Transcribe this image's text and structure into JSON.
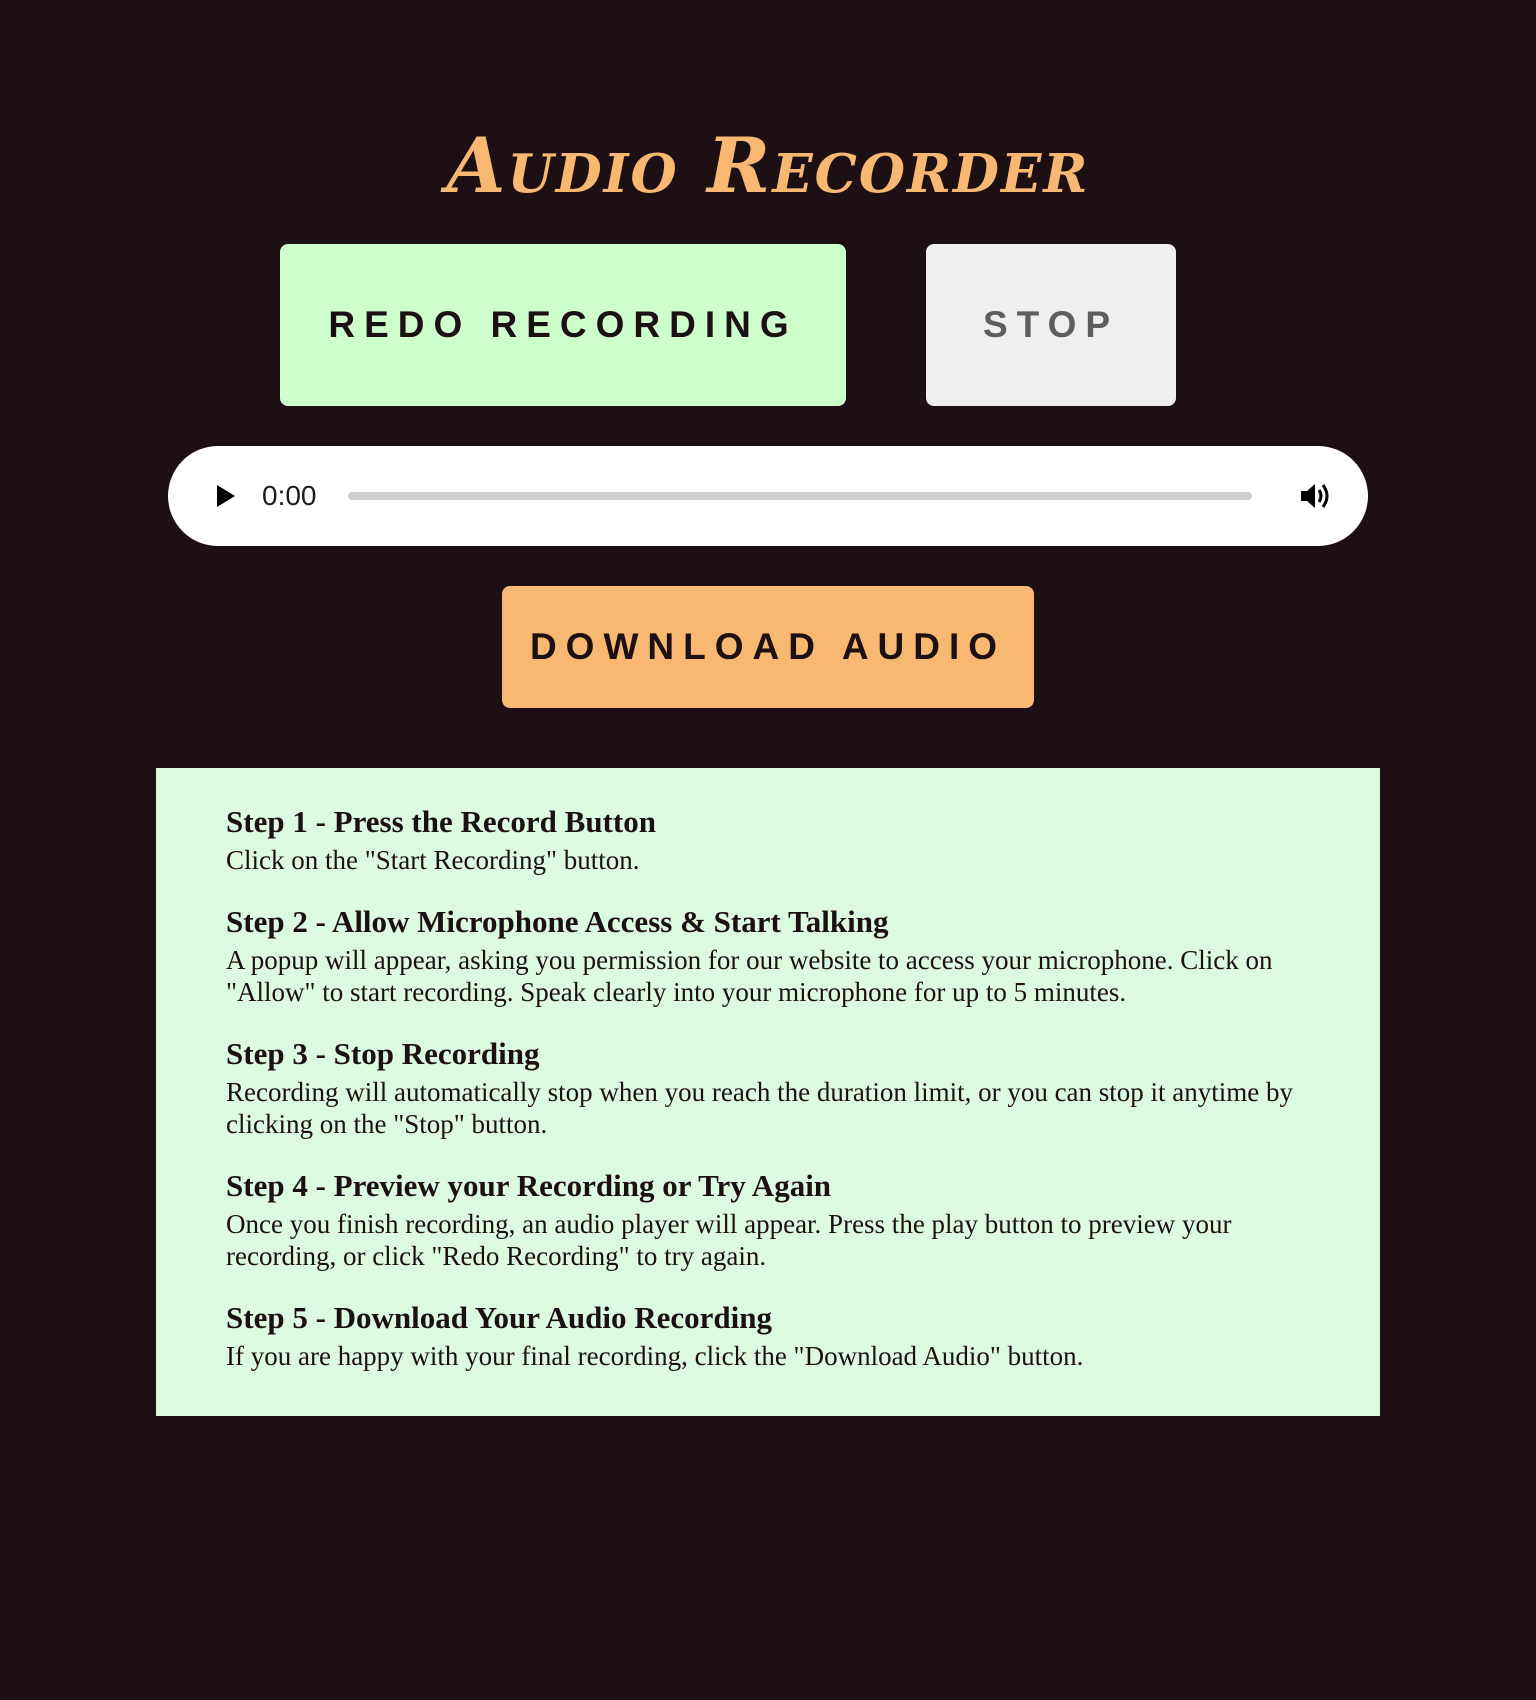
{
  "header": {
    "title": "Audio Recorder"
  },
  "controls": {
    "redo_label": "REDO RECORDING",
    "stop_label": "STOP",
    "download_label": "DOWNLOAD AUDIO"
  },
  "player": {
    "time": "0:00",
    "progress": 0,
    "play_icon": "play-icon",
    "volume_icon": "volume-icon"
  },
  "steps": [
    {
      "title": "Step 1 - Press the Record Button",
      "body": "Click on the \"Start Recording\" button."
    },
    {
      "title": "Step 2 - Allow Microphone Access & Start Talking",
      "body": "A popup will appear, asking you permission for our website to access your microphone. Click on \"Allow\" to start recording. Speak clearly into your microphone for up to 5 minutes."
    },
    {
      "title": "Step 3 - Stop Recording",
      "body": "Recording will automatically stop when you reach the duration limit, or you can stop it anytime by clicking on the \"Stop\" button."
    },
    {
      "title": "Step 4 - Preview your Recording or Try Again",
      "body": "Once you finish recording, an audio player will appear. Press the play button to preview your recording, or click \"Redo Recording\" to try again."
    },
    {
      "title": "Step 5 - Download Your Audio Recording",
      "body": "If you are happy with your final recording, click the \"Download Audio\" button."
    }
  ],
  "colors": {
    "background": "#1d1015",
    "accent": "#f9b872",
    "redo_bg": "#ccffcc",
    "stop_bg": "#efefef",
    "steps_bg": "#dcfadf"
  }
}
